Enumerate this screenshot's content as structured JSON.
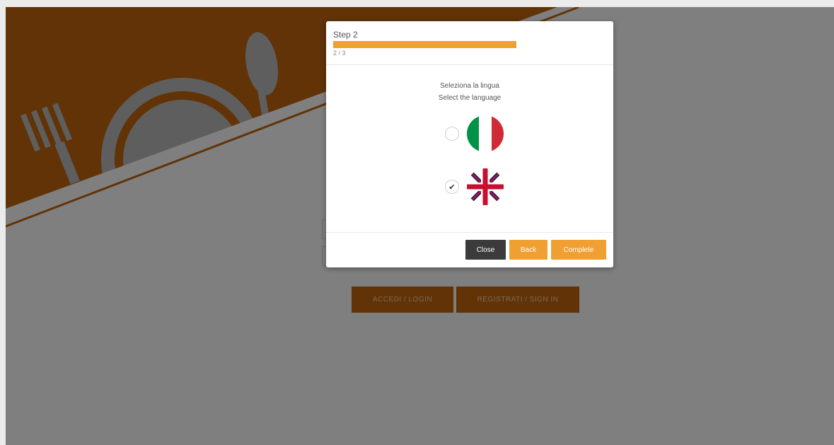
{
  "background_page": {
    "login_buttons": [
      "ACCEDI / LOGIN",
      "REGISTRATI / SIGN IN"
    ],
    "colors": {
      "brand": "#c2660f",
      "decor": "#bdbdbd"
    }
  },
  "modal": {
    "title": "Step 2",
    "progress": {
      "current": 2,
      "total": 3,
      "label": "2 / 3",
      "fraction": 0.67
    },
    "prompt_it": "Seleziona la lingua",
    "prompt_en": "Select the language",
    "languages": [
      {
        "code": "it",
        "flag": "italy-flag-icon",
        "selected": false
      },
      {
        "code": "en",
        "flag": "uk-flag-icon",
        "selected": true
      }
    ],
    "buttons": {
      "close": "Close",
      "back": "Back",
      "complete": "Complete"
    },
    "colors": {
      "accent": "#f0a032",
      "close_button": "#3b3b3b"
    }
  }
}
